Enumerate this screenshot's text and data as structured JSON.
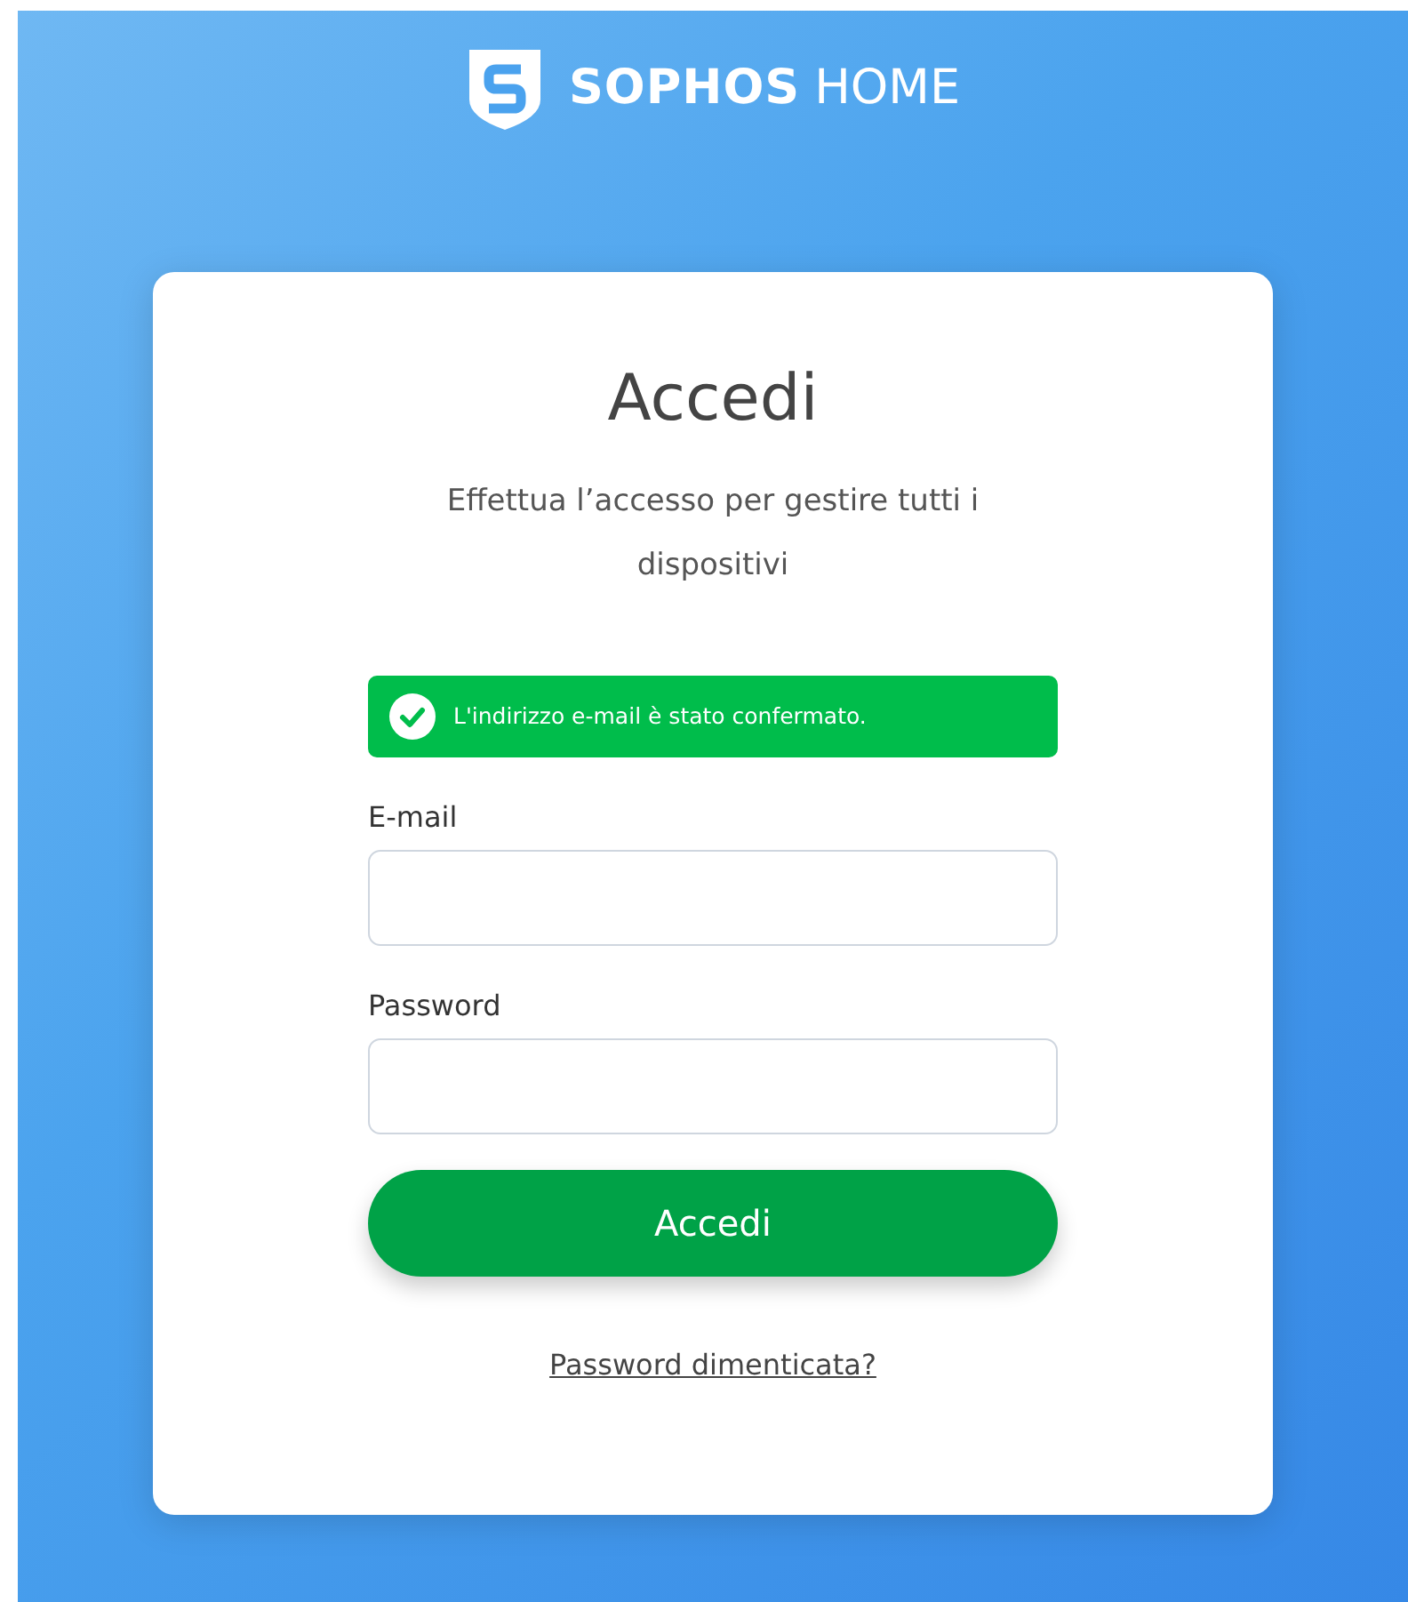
{
  "brand": {
    "name": "SOPHOS",
    "suffix": "HOME"
  },
  "title": "Accedi",
  "subtitle": "Effettua l’accesso per gestire tutti i dispositivi",
  "alert": {
    "kind": "success",
    "text": "L'indirizzo e-mail è stato confermato."
  },
  "fields": [
    {
      "label": "E-mail"
    },
    {
      "label": "Password"
    }
  ],
  "submit": "Accedi",
  "forgot_link": "Password dimenticata?"
}
